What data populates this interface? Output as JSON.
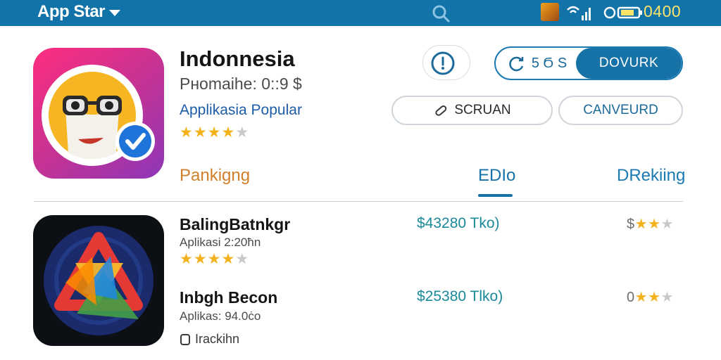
{
  "topbar": {
    "brand": "App Star",
    "clock": "0400",
    "icons": [
      "chevron-down-icon",
      "search-icon",
      "notification-image-icon",
      "wifi-signal-icon",
      "battery-icon"
    ],
    "color": "#1173a8"
  },
  "featured": {
    "title": "Indonnesia",
    "subtitle": "Pнomaihe: 0::9  $",
    "category": "Applikasia Popular",
    "rating": 4,
    "rating_max": 5,
    "icon": "emoji-glasses-verified-icon",
    "accent": "#ff2d7e"
  },
  "actions": {
    "update_count": "5 Ϭ S",
    "download_label": "DOVURK",
    "search_label": "SCRUAN",
    "cancel_label": "CANVEURD"
  },
  "tabs": [
    {
      "label": "Pankigng",
      "active": false
    },
    {
      "label": "EDIo",
      "active": true
    },
    {
      "label": "DRekiing",
      "active": false
    }
  ],
  "list": [
    {
      "title": "BalingBatnkgr",
      "subtitle": "Aplikasi 2:20ħn",
      "price": "$43280 Tko)",
      "rating": 4,
      "rating_max": 5,
      "rate_prefix": "$",
      "rate_stars": 2,
      "rate_max": 3,
      "icon": "colorful-triangles-icon"
    },
    {
      "title": "Inbgh Becon",
      "subtitle": "Aplikas: 94.0ċo",
      "price": "$25380 Tlko)",
      "rate_prefix": "0",
      "rate_stars": 2,
      "rate_max": 3,
      "track_label": "Irackihn",
      "icon": "app-icon"
    }
  ],
  "colors": {
    "primary": "#1672a7",
    "star": "#f2b21b",
    "price": "#1a8a9a",
    "tab_orange": "#d07f2a"
  }
}
